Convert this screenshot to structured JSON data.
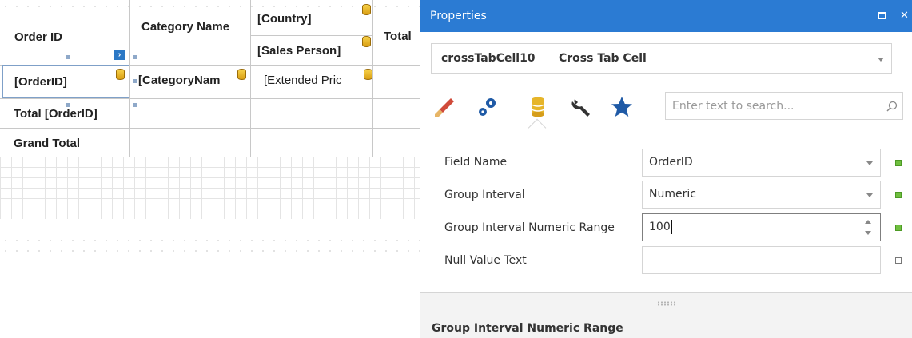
{
  "crosstab": {
    "headers": {
      "order_id": "Order ID",
      "category_name": "Category Name",
      "country": "[Country]",
      "sales_person": "[Sales Person]",
      "total": "Total"
    },
    "rows": {
      "orderid_field": "[OrderID]",
      "category_field": "[CategoryNam",
      "extended_price_field": "[Extended Pric",
      "total_orderid": "Total [OrderID]",
      "grand_total": "Grand Total"
    }
  },
  "properties": {
    "title": "Properties",
    "header_icons": {
      "maximize": "maximize-icon",
      "close": "close-icon"
    },
    "object": {
      "name": "crossTabCell10",
      "type": "Cross Tab Cell"
    },
    "toolbar": [
      "brush-icon",
      "gears-icon",
      "database-icon",
      "wrench-icon",
      "star-icon"
    ],
    "search": {
      "placeholder": "Enter text to search...",
      "icon": "search-icon"
    },
    "rows": [
      {
        "label": "Field Name",
        "value": "OrderID",
        "editor": "dropdown",
        "modified": true
      },
      {
        "label": "Group Interval",
        "value": "Numeric",
        "editor": "dropdown",
        "modified": true
      },
      {
        "label": "Group Interval Numeric Range",
        "value": "100",
        "editor": "spin",
        "modified": true
      },
      {
        "label": "Null Value Text",
        "value": "",
        "editor": "text",
        "modified": false
      }
    ],
    "description_title": "Group Interval Numeric Range"
  },
  "colors": {
    "header_blue": "#2b7bd3",
    "modified_green": "#6fbf3f",
    "db_gold": "#e6b52a"
  }
}
